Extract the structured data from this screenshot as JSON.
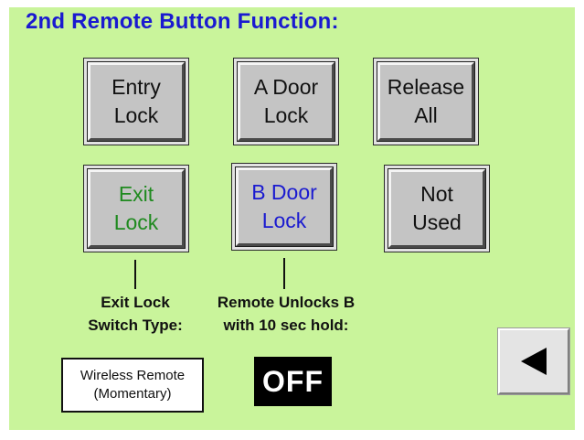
{
  "title": "2nd Remote Button Function:",
  "buttons": {
    "entry_lock": {
      "label": "Entry\nLock",
      "color": "#111111"
    },
    "a_door_lock": {
      "label": "A Door\nLock",
      "color": "#111111"
    },
    "release_all": {
      "label": "Release\nAll",
      "color": "#111111"
    },
    "exit_lock": {
      "label": "Exit\nLock",
      "color": "#1f8a1f"
    },
    "b_door_lock": {
      "label": "B Door\nLock",
      "color": "#1a1ad0"
    },
    "not_used": {
      "label": "Not\nUsed",
      "color": "#111111"
    }
  },
  "exit_lock_switch": {
    "caption": "Exit Lock\nSwitch Type:",
    "value": "Wireless Remote\n(Momentary)"
  },
  "remote_unlock": {
    "caption": "Remote Unlocks B\nwith 10 sec hold:",
    "value": "OFF"
  },
  "back_button": {
    "icon": "left-arrow-icon"
  },
  "colors": {
    "background": "#c9f49b",
    "title": "#1a1ad0",
    "button_face": "#c4c4c4"
  }
}
